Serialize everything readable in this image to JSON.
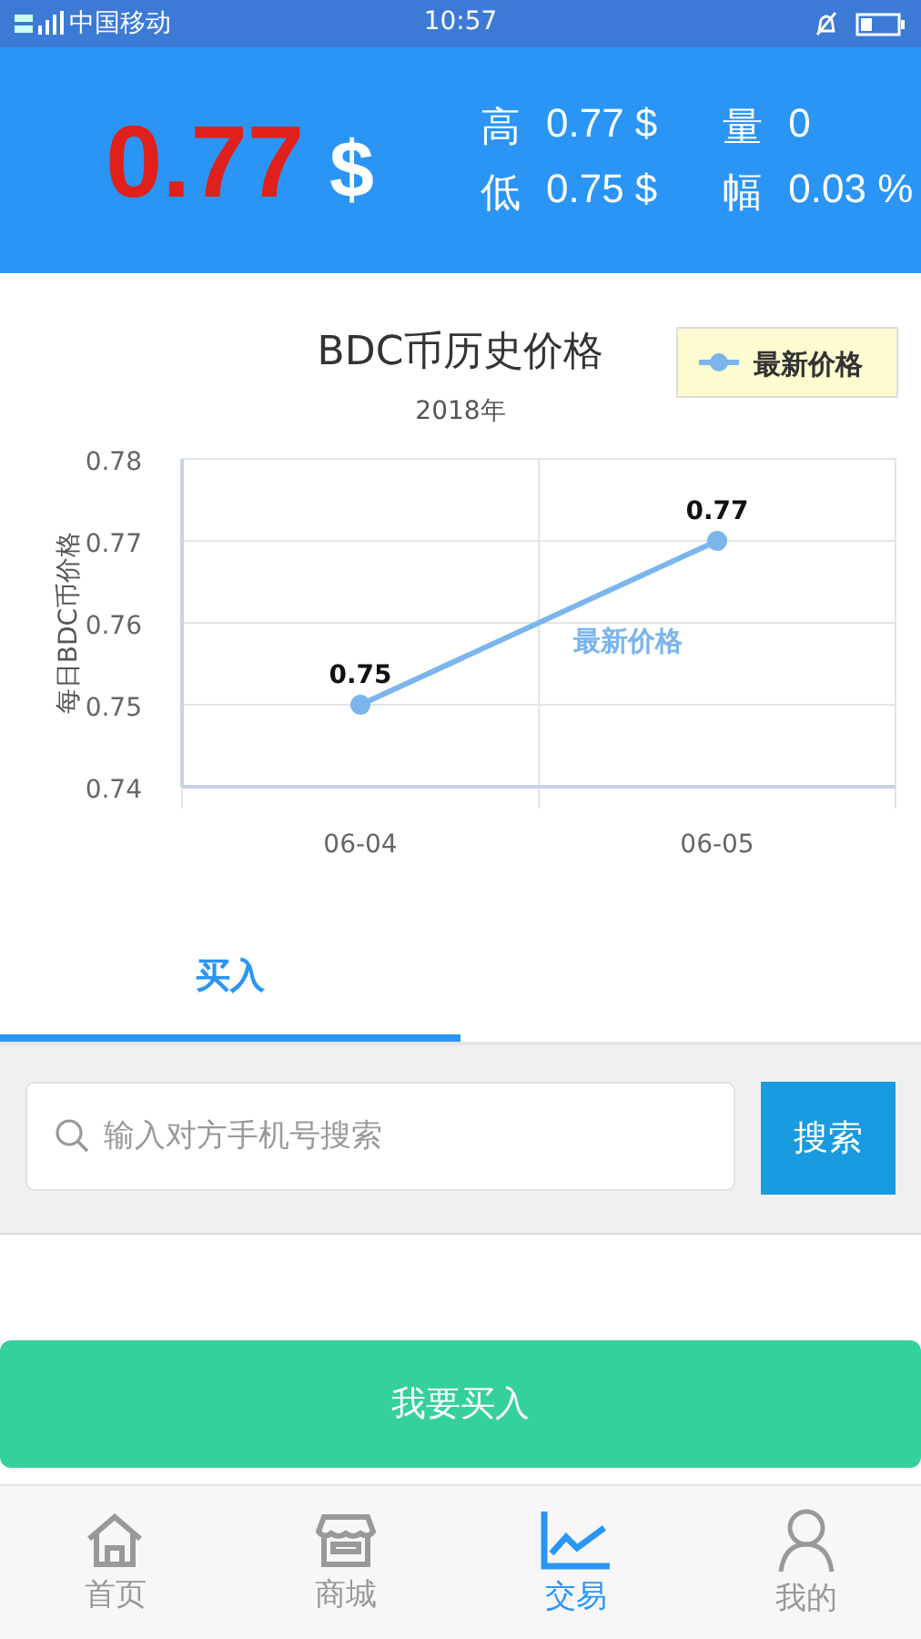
{
  "status_bar": {
    "carrier": "中国移动",
    "time": "10:57"
  },
  "header": {
    "price": "0.77",
    "currency": "$",
    "stats": [
      {
        "label": "高",
        "value": "0.77 $"
      },
      {
        "label": "量",
        "value": "0"
      },
      {
        "label": "低",
        "value": "0.75 $"
      },
      {
        "label": "幅",
        "value": "0.03 %"
      }
    ]
  },
  "chart": {
    "chart_data": {
      "type": "line",
      "title": "BDC币历史价格",
      "subtitle": "2018年",
      "ylabel": "每日BDC币价格",
      "categories": [
        "06-04",
        "06-05"
      ],
      "series": [
        {
          "name": "最新价格",
          "color": "#7cb5ec",
          "marker": "circle",
          "values": [
            0.75,
            0.77
          ]
        }
      ],
      "grid": true,
      "ylim": [
        0.74,
        0.78
      ],
      "yticks": [
        0.74,
        0.75,
        0.76,
        0.77,
        0.78
      ],
      "data_labels": true,
      "annotations": [
        "最新价格"
      ]
    }
  },
  "tabs": [
    {
      "label": "买入",
      "selected": true
    }
  ],
  "search": {
    "placeholder": "输入对方手机号搜索",
    "button": "搜索"
  },
  "action_button": "我要买入",
  "bottom_nav": [
    {
      "kind": "home",
      "label": "首页",
      "selected": false
    },
    {
      "kind": "store",
      "label": "商城",
      "selected": false
    },
    {
      "kind": "chart",
      "label": "交易",
      "selected": true
    },
    {
      "kind": "person",
      "label": "我的",
      "selected": false
    }
  ]
}
